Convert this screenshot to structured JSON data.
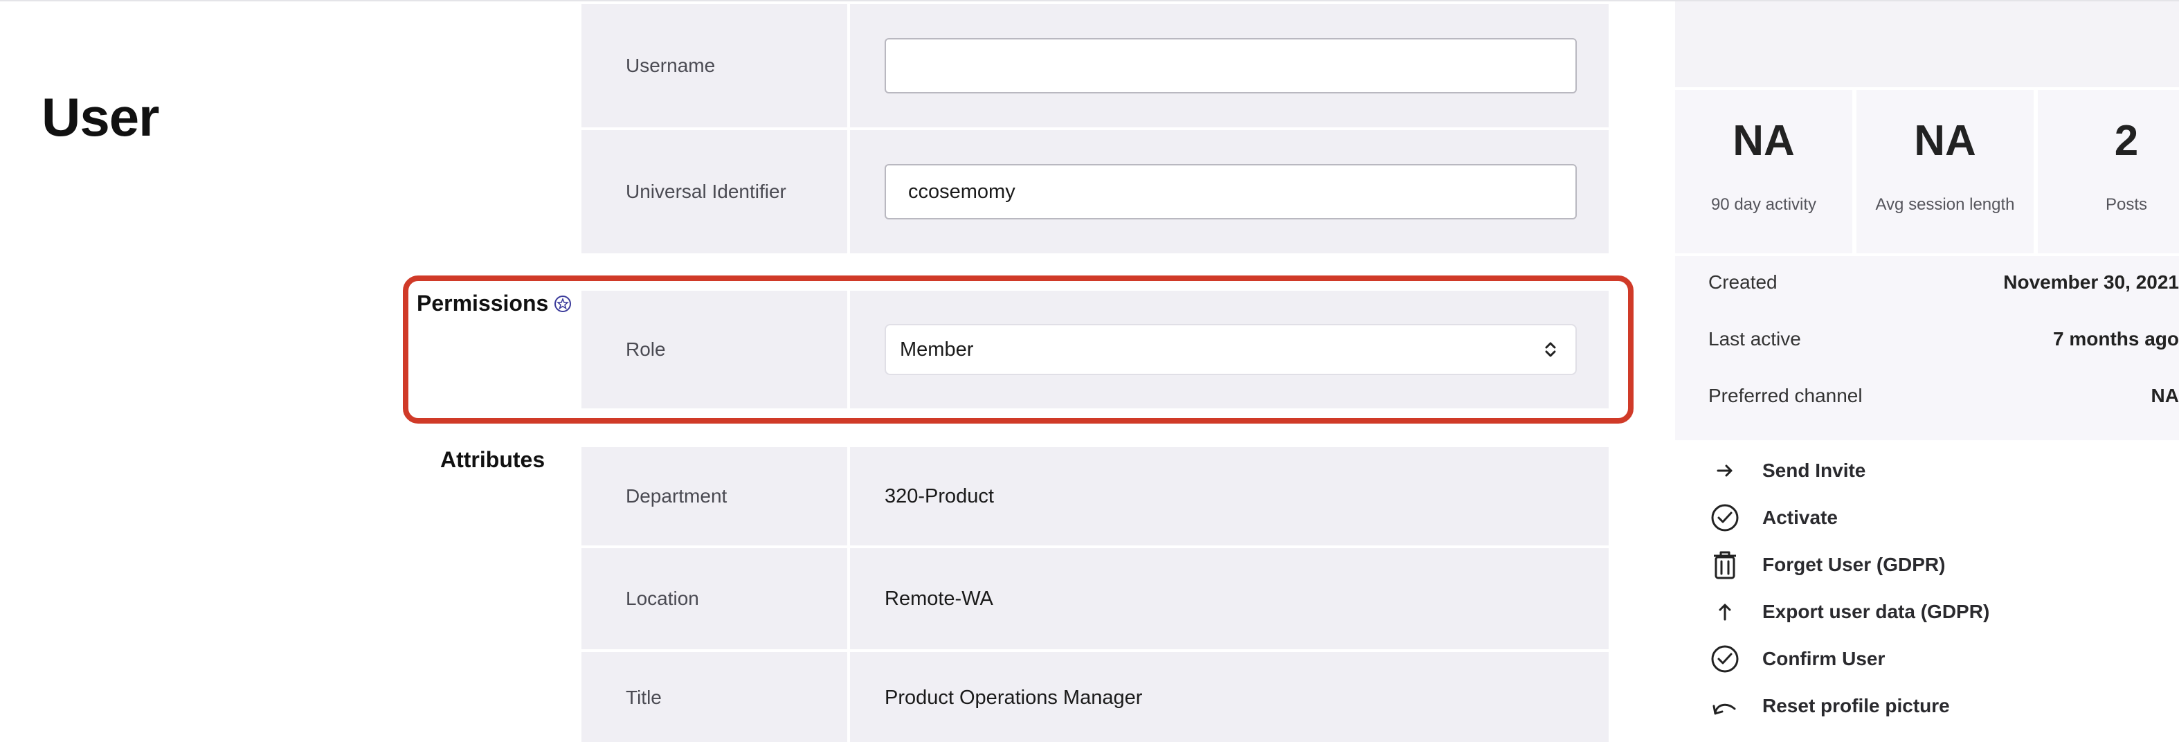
{
  "page": {
    "title": "User"
  },
  "form": {
    "username": {
      "label": "Username",
      "value": "",
      "placeholder": ""
    },
    "universal_identifier": {
      "label": "Universal Identifier",
      "value": "ccosemomy"
    },
    "permissions": {
      "heading": "Permissions",
      "role": {
        "label": "Role",
        "value": "Member"
      }
    },
    "attributes": {
      "heading": "Attributes",
      "department": {
        "label": "Department",
        "value": "320-Product"
      },
      "location": {
        "label": "Location",
        "value": "Remote-WA"
      },
      "title": {
        "label": "Title",
        "value": "Product Operations Manager"
      }
    }
  },
  "stats": [
    {
      "value": "NA",
      "label": "90 day activity"
    },
    {
      "value": "NA",
      "label": "Avg session length"
    },
    {
      "value": "2",
      "label": "Posts"
    }
  ],
  "details": {
    "created": {
      "label": "Created",
      "value": "November 30, 2021"
    },
    "last_active": {
      "label": "Last active",
      "value": "7 months ago"
    },
    "preferred_channel": {
      "label": "Preferred channel",
      "value": "NA"
    }
  },
  "actions": [
    {
      "label": "Send Invite",
      "icon": "arrow-right-icon"
    },
    {
      "label": "Activate",
      "icon": "check-circle-icon"
    },
    {
      "label": "Forget User (GDPR)",
      "icon": "trash-icon"
    },
    {
      "label": "Export user data (GDPR)",
      "icon": "arrow-up-icon"
    },
    {
      "label": "Confirm User",
      "icon": "check-circle-icon"
    },
    {
      "label": "Reset profile picture",
      "icon": "undo-icon"
    }
  ],
  "colors": {
    "highlight": "#d03a28",
    "row_background": "#f0eff4"
  }
}
